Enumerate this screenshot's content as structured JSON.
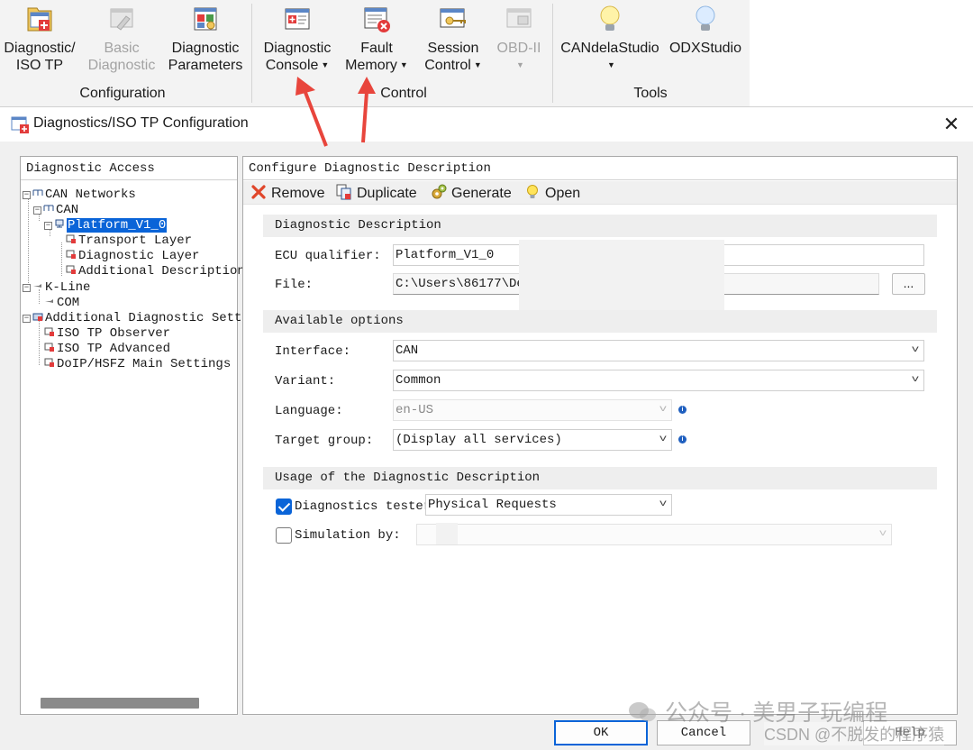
{
  "ribbon": {
    "groups": {
      "configuration": "Configuration",
      "control": "Control",
      "tools": "Tools"
    },
    "buttons": {
      "diagnostic_iso_tp": [
        "Diagnostic/",
        "ISO TP"
      ],
      "basic_diagnostic": [
        "Basic",
        "Diagnostic"
      ],
      "diagnostic_parameters": [
        "Diagnostic",
        "Parameters"
      ],
      "diagnostic_console": [
        "Diagnostic",
        "Console"
      ],
      "fault_memory": [
        "Fault",
        "Memory"
      ],
      "session_control": [
        "Session",
        "Control"
      ],
      "obd_ii": "OBD-II",
      "candelastudio": "CANdelaStudio",
      "odxstudio": "ODXStudio"
    }
  },
  "dialog": {
    "title": "Diagnostics/ISO TP Configuration",
    "close_glyph": "✕",
    "left_panel": {
      "header": "Diagnostic Access",
      "tree": {
        "can_networks": "CAN Networks",
        "can": "CAN",
        "platform": "Platform_V1_0",
        "transport_layer": "Transport Layer",
        "diagnostic_layer": "Diagnostic Layer",
        "additional_description": "Additional Description",
        "k_line": "K-Line",
        "com": "COM",
        "additional_settings": "Additional Diagnostic Setti",
        "iso_tp_observer": "ISO TP Observer",
        "iso_tp_advanced": "ISO TP Advanced",
        "doip": "DoIP/HSFZ Main Settings"
      },
      "expand_minus": "−",
      "expand_plus": "+"
    },
    "right_panel": {
      "header": "Configure Diagnostic Description",
      "toolbar": {
        "remove": "Remove",
        "duplicate": "Duplicate",
        "generate": "Generate",
        "open": "Open"
      },
      "diag_description": {
        "title": "Diagnostic Description",
        "ecu_label": "ECU qualifier:",
        "ecu_value": "Platform_V1_0",
        "file_label": "File:",
        "file_value": "C:\\Users\\86177\\De",
        "browse": "..."
      },
      "available_options": {
        "title": "Available options",
        "interface_label": "Interface:",
        "interface_value": "CAN",
        "variant_label": "Variant:",
        "variant_value": "Common",
        "language_label": "Language:",
        "language_value": "en-US",
        "target_label": "Target group:",
        "target_value": "(Display all services)",
        "info": "i"
      },
      "usage": {
        "title": "Usage of the Diagnostic Description",
        "tester_label": "Diagnostics tester",
        "tester_value": "Physical Requests",
        "tester_checked": true,
        "simulation_label": "Simulation by:",
        "simulation_value": "",
        "simulation_checked": false
      }
    },
    "buttons": {
      "ok": "OK",
      "cancel": "Cancel",
      "help": "Help"
    }
  },
  "watermark": {
    "line1": "公众号 · 美男子玩编程",
    "line2": "CSDN @不脱发的程序猿"
  },
  "colors": {
    "accent": "#0a64d8",
    "arrow": "#e8453c"
  }
}
